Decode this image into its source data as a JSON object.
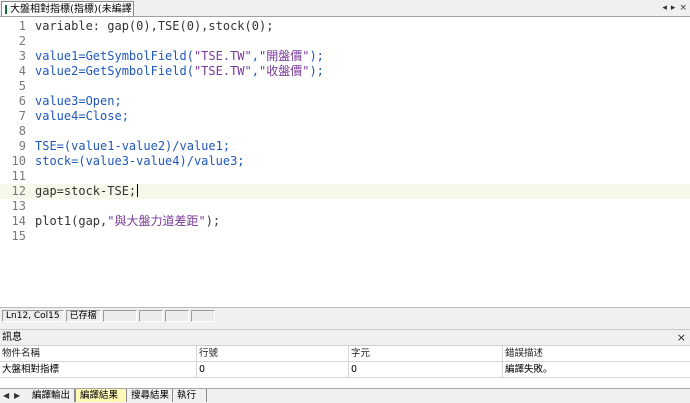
{
  "tab": {
    "title": "大盤相對指標(指標)(未編譯)",
    "close": "×"
  },
  "tab_controls": {
    "prev": "◂",
    "next": "▸",
    "close": "×"
  },
  "editor": {
    "current_line": 12,
    "lines": [
      {
        "n": "1",
        "parts": [
          {
            "t": "variable: gap(0),TSE(0),stock(0);",
            "c": "text"
          }
        ]
      },
      {
        "n": "2",
        "parts": []
      },
      {
        "n": "3",
        "parts": [
          {
            "t": "value1=GetSymbolField(",
            "c": "blue"
          },
          {
            "t": "\"TSE.TW\"",
            "c": "purple"
          },
          {
            "t": ",",
            "c": "blue"
          },
          {
            "t": "\"開盤價\"",
            "c": "purple"
          },
          {
            "t": ");",
            "c": "blue"
          }
        ]
      },
      {
        "n": "4",
        "parts": [
          {
            "t": "value2=GetSymbolField(",
            "c": "blue"
          },
          {
            "t": "\"TSE.TW\"",
            "c": "purple"
          },
          {
            "t": ",",
            "c": "blue"
          },
          {
            "t": "\"收盤價\"",
            "c": "purple"
          },
          {
            "t": ");",
            "c": "blue"
          }
        ]
      },
      {
        "n": "5",
        "parts": []
      },
      {
        "n": "6",
        "parts": [
          {
            "t": "value3=Open;",
            "c": "blue"
          }
        ]
      },
      {
        "n": "7",
        "parts": [
          {
            "t": "value4=Close;",
            "c": "blue"
          }
        ]
      },
      {
        "n": "8",
        "parts": []
      },
      {
        "n": "9",
        "parts": [
          {
            "t": "TSE=(value1-value2)/value1;",
            "c": "blue"
          }
        ]
      },
      {
        "n": "10",
        "parts": [
          {
            "t": "stock=(value3-value4)/value3;",
            "c": "blue"
          }
        ]
      },
      {
        "n": "11",
        "parts": []
      },
      {
        "n": "12",
        "parts": [
          {
            "t": "gap=stock-TSE;",
            "c": "text"
          }
        ]
      },
      {
        "n": "13",
        "parts": []
      },
      {
        "n": "14",
        "parts": [
          {
            "t": "plot1(gap,",
            "c": "text"
          },
          {
            "t": "\"與大盤力道差距\"",
            "c": "purple"
          },
          {
            "t": ");",
            "c": "text"
          }
        ]
      },
      {
        "n": "15",
        "parts": []
      }
    ]
  },
  "status_bar": {
    "position": "Ln12, Col15",
    "save_state": "已存檔"
  },
  "messages": {
    "title": "訊息",
    "close": "×",
    "columns": [
      "物件名稱",
      "行號",
      "字元",
      "錯誤描述"
    ],
    "rows": [
      [
        "大盤相對指標",
        "0",
        "0",
        "編譯失敗。"
      ]
    ]
  },
  "bottom_tabs": {
    "prev": "◀",
    "next": "▶",
    "items": [
      "編譯輸出",
      "編譯結果",
      "搜尋結果",
      "執行"
    ],
    "active": 1
  },
  "colors": {
    "keyword": "#1f57b8",
    "string": "#7a3b98",
    "active_tab": "#fff8b8",
    "current_line": "#f7f7ea"
  }
}
